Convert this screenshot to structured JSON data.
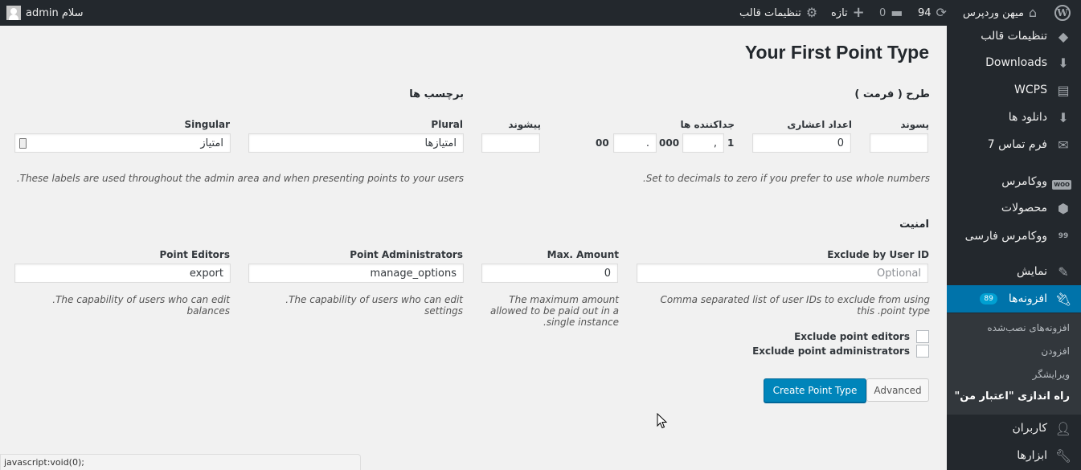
{
  "adminbar": {
    "greeting": "سلام admin",
    "site_name": "میهن وردپرس",
    "updates_count": "94",
    "comments_count": "0",
    "new_label": "تازه",
    "theme_settings_label": "تنظیمات قالب"
  },
  "sidebar": {
    "items": [
      {
        "label": "تنظیمات قالب",
        "icon": "diamond-icon"
      },
      {
        "label": "Downloads",
        "icon": "download-icon"
      },
      {
        "label": "WCPS",
        "icon": "document-icon"
      },
      {
        "label": "دانلود ها",
        "icon": "download-icon"
      },
      {
        "label": "فرم تماس 7",
        "icon": "mail-icon"
      },
      {
        "label": "ووکامرس",
        "icon": "woo-icon"
      },
      {
        "label": "محصولات",
        "icon": "box-icon"
      },
      {
        "label": "ووکامرس فارسی",
        "icon": "quote-icon"
      },
      {
        "label": "نمایش",
        "icon": "brush-icon"
      },
      {
        "label": "افزونه‌ها",
        "icon": "plugin-icon",
        "badge": "89"
      },
      {
        "label": "کاربران",
        "icon": "user-icon"
      },
      {
        "label": "ابزارها",
        "icon": "wrench-icon"
      }
    ],
    "submenu": [
      {
        "label": "افزونه‌های نصب‌شده"
      },
      {
        "label": "افزودن"
      },
      {
        "label": "ویرایشگر"
      },
      {
        "label": "راه اندازی \"اعتبار من\""
      }
    ],
    "woo_badge_text": "WOO",
    "quote_badge_text": "99"
  },
  "page": {
    "title": "Your First Point Type",
    "format_section": {
      "heading": "طرح ( فرمت )",
      "suffix_label": "پسوند",
      "suffix_value": "",
      "decimals_label": "اعداد اعشاری",
      "decimals_value": "0",
      "separators_label": "جداکننده ها",
      "sep_prefix_text": "1",
      "thousands_sep_value": ",",
      "thousands_text": "000",
      "decimal_sep_value": ".",
      "decimal_text": "00",
      "prefix_label": "پیشوند",
      "prefix_value": "",
      "description": ".Set to decimals to zero if you prefer to use whole numbers"
    },
    "labels_section": {
      "heading": "برچسب ها",
      "plural_label": "Plural",
      "plural_value": "امتیازها",
      "singular_label": "Singular",
      "singular_value": "امتیاز",
      "description": ".These labels are used throughout the admin area and when presenting points to your users"
    },
    "security_section": {
      "heading": "امنیت",
      "exclude_label": "Exclude by User ID",
      "exclude_placeholder": "Optional",
      "exclude_description": "Comma separated list of user IDs to exclude from using this .point type",
      "max_amount_label": "Max. Amount",
      "max_amount_value": "0",
      "max_amount_description": "The maximum amount allowed to be paid out in a .single instance",
      "point_admins_label": "Point Administrators",
      "point_admins_value": "manage_options",
      "point_admins_description": ".The capability of users who can edit settings",
      "point_editors_label": "Point Editors",
      "point_editors_value": "export",
      "point_editors_description": ".The capability of users who can edit balances",
      "exclude_editors_label": "Exclude point editors",
      "exclude_editors_checked": false,
      "exclude_admins_label": "Exclude point administrators",
      "exclude_admins_checked": false
    },
    "buttons": {
      "create_label": "Create Point Type",
      "advanced_label": "Advanced"
    }
  },
  "statusbar": {
    "text": "javascript:void(0);"
  },
  "colors": {
    "primary": "#0085ba",
    "sidebar_bg": "#23282d",
    "current_menu": "#0073aa",
    "badge": "#00a0d2"
  }
}
